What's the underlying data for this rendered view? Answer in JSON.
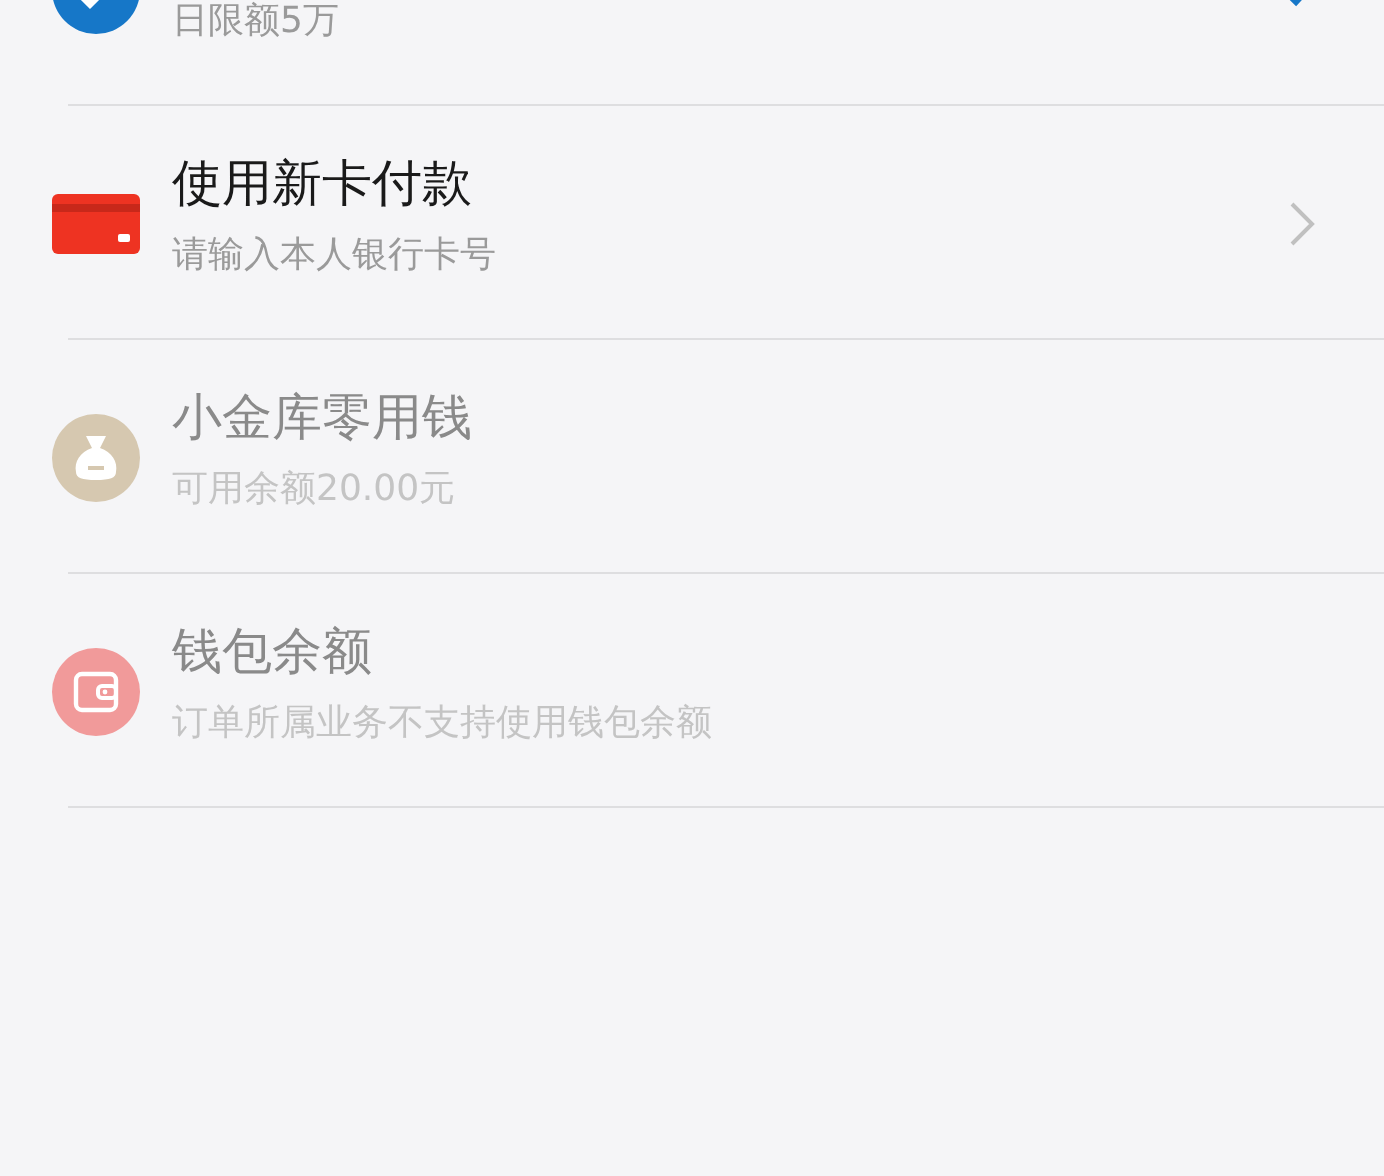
{
  "payment_methods": [
    {
      "kind": "bank",
      "subtitle": "日限额5万",
      "selected": true,
      "disabled": false,
      "cut": true
    },
    {
      "kind": "new_card",
      "title": "使用新卡付款",
      "subtitle": "请输入本人银行卡号",
      "selected": false,
      "disabled": false
    },
    {
      "kind": "vault",
      "title": "小金库零用钱",
      "subtitle": "可用余额20.00元",
      "selected": false,
      "disabled": true
    },
    {
      "kind": "wallet",
      "title": "钱包余额",
      "subtitle": "订单所属业务不支持使用钱包余额",
      "selected": false,
      "disabled": true
    }
  ]
}
